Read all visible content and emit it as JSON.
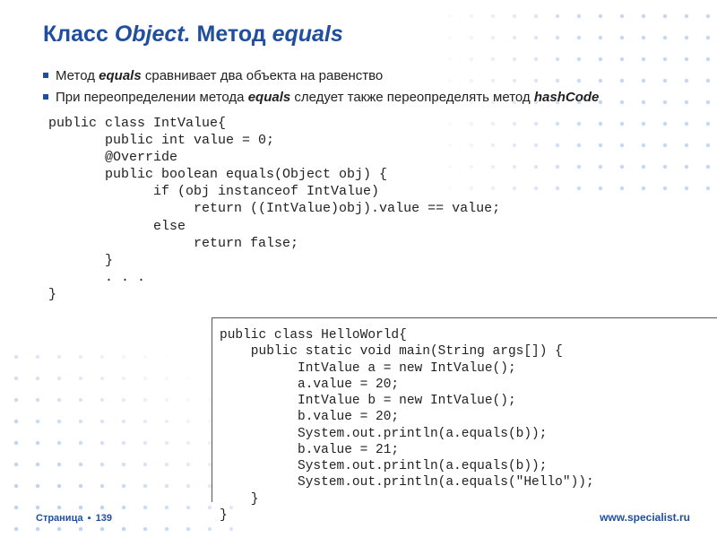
{
  "title": {
    "part1": "Класс ",
    "em1": "Object.",
    "part2": " Метод ",
    "em2": "equals"
  },
  "bullets": [
    {
      "pre": "Метод ",
      "em": "equals",
      "post": " сравнивает два объекта на равенство"
    },
    {
      "pre": "При переопределении метода ",
      "em": "equals",
      "post": " следует также переопределять метод ",
      "em2": "hashCode"
    }
  ],
  "code1": "public class IntValue{\n       public int value = 0;\n       @Override\n       public boolean equals(Object obj) {\n             if (obj instanceof IntValue)\n                  return ((IntValue)obj).value == value;\n             else\n                  return false;\n       }\n       . . .\n}",
  "code2": "public class HelloWorld{\n    public static void main(String args[]) {\n          IntValue a = new IntValue();\n          a.value = 20;\n          IntValue b = new IntValue();\n          b.value = 20;\n          System.out.println(a.equals(b));\n          b.value = 21;\n          System.out.println(a.equals(b));\n          System.out.println(a.equals(\"Hello\"));\n    }\n}",
  "footer": {
    "page_label": "Страница",
    "page_num": "139",
    "url": "www.specialist.ru"
  }
}
